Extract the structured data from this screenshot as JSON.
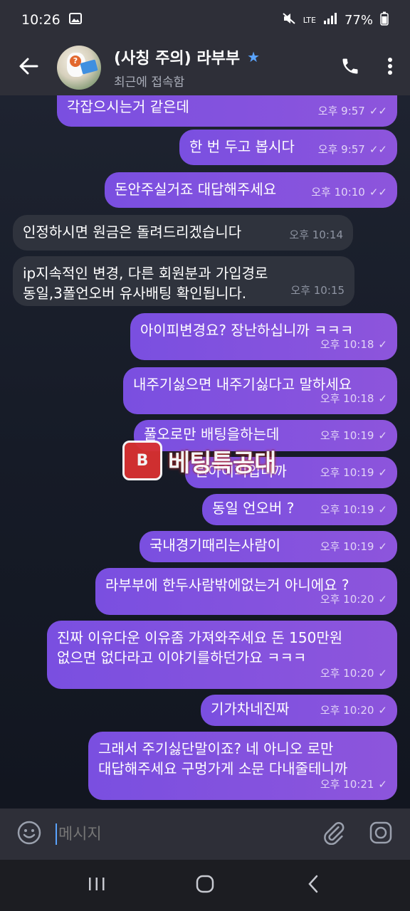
{
  "status": {
    "time": "10:26",
    "battery": "77%",
    "signal_label": "LTE"
  },
  "header": {
    "title": "(사칭 주의) 라부부",
    "subtitle": "최근에 접속함"
  },
  "messages": [
    {
      "dir": "out",
      "text": "각잡으시는거 같은데",
      "time": "오후 9:57",
      "status": "read"
    },
    {
      "dir": "out",
      "text": "한 번 두고 봅시다",
      "time": "오후 9:57",
      "status": "read"
    },
    {
      "dir": "out",
      "text": "돈안주실거죠 대답해주세요",
      "time": "오후 10:10",
      "status": "read"
    },
    {
      "dir": "in",
      "text": "인정하시면 원금은 돌려드리겠습니다",
      "time": "오후 10:14"
    },
    {
      "dir": "in",
      "text": "ip지속적인 변경, 다른 회원분과 가입경로\n동일,3폴언오버 유사배팅 확인됩니다.",
      "time": "오후 10:15"
    },
    {
      "dir": "out",
      "text": "아이피변경요? 장난하십니까 ㅋㅋㅋ",
      "time": "오후 10:18",
      "status": "sent"
    },
    {
      "dir": "out",
      "text": "내주기싫으면 내주기싫다고 말하세요",
      "time": "오후 10:18",
      "status": "sent"
    },
    {
      "dir": "out",
      "text": "풀오로만 배팅을하는데",
      "time": "오후 10:19",
      "status": "sent"
    },
    {
      "dir": "out",
      "text": "뭔아이피입니까",
      "time": "오후 10:19",
      "status": "sent"
    },
    {
      "dir": "out",
      "text": "동일 언오버 ?",
      "time": "오후 10:19",
      "status": "sent"
    },
    {
      "dir": "out",
      "text": "국내경기때리는사람이",
      "time": "오후 10:19",
      "status": "sent"
    },
    {
      "dir": "out",
      "text": "라부부에 한두사람밖에없는거 아니에요 ?",
      "time": "오후 10:20",
      "status": "sent"
    },
    {
      "dir": "out",
      "text": "진짜 이유다운 이유좀 가져와주세요 돈 150만원\n없으면 없다라고 이야기를하던가요 ㅋㅋㅋ",
      "time": "오후 10:20",
      "status": "sent"
    },
    {
      "dir": "out",
      "text": "기가차네진짜",
      "time": "오후 10:20",
      "status": "sent"
    },
    {
      "dir": "out",
      "text": "그래서 주기싫단말이죠? 네 아니오 로만\n대답해주세요 구멍가게 소문 다내줄테니까",
      "time": "오후 10:21",
      "status": "sent"
    }
  ],
  "watermark": {
    "logo_text": "B",
    "text": "베팅특공대"
  },
  "input": {
    "placeholder": "메시지"
  },
  "icons": {
    "back": "arrow-left-icon",
    "call": "phone-icon",
    "menu": "more-vertical-icon",
    "emoji": "emoji-icon",
    "attach": "paperclip-icon",
    "camera": "camera-icon"
  },
  "colors": {
    "outgoing_bubble": "#8a52e0",
    "incoming_bubble": "#2f333d",
    "accent": "#5aa4ff"
  }
}
